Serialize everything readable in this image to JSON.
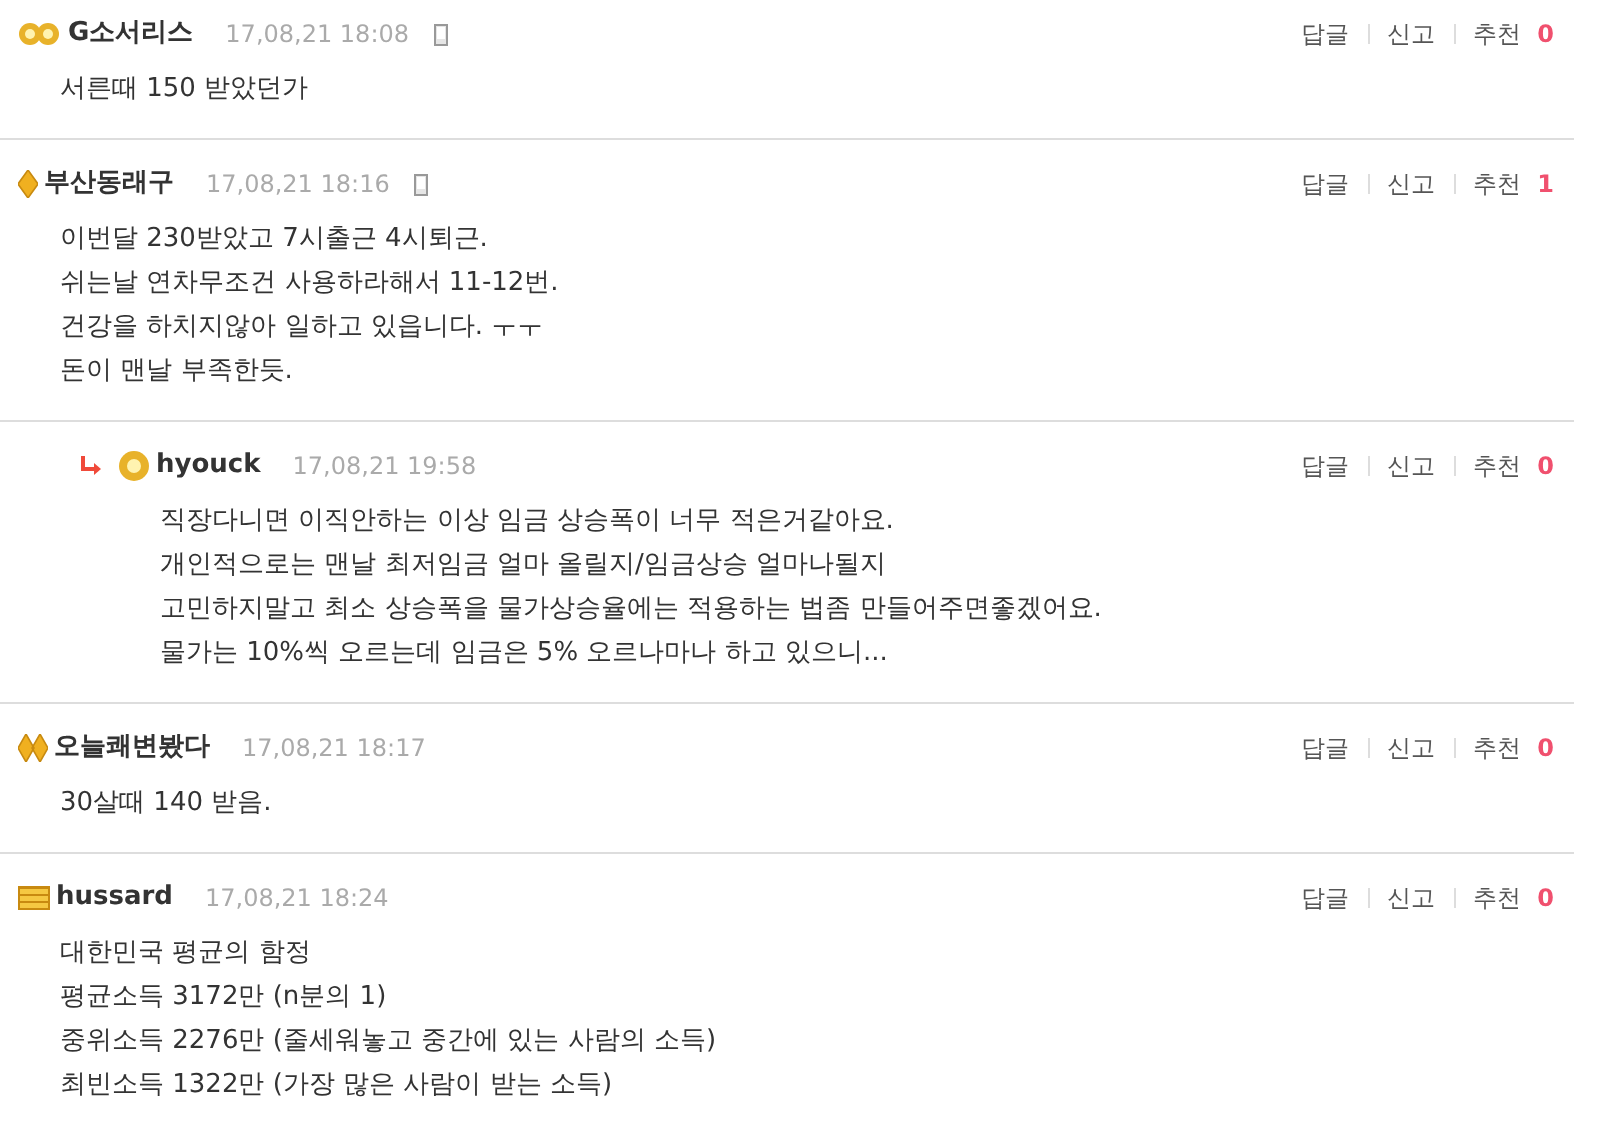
{
  "comments": [
    {
      "kind": "comment",
      "badge": {
        "kind": "flower-cluster"
      },
      "author": "G소서리스",
      "date": "17,08,21 18:08",
      "mobile": true,
      "actions": [
        "답글",
        "신고",
        "추천"
      ],
      "recommend_count": "0",
      "lines": [
        "서른때 150 받았던가"
      ]
    },
    {
      "kind": "comment",
      "badge": {
        "kind": "diamond"
      },
      "author": "부산동래구",
      "date": "17,08,21 18:16",
      "mobile": true,
      "actions": [
        "답글",
        "신고",
        "추천"
      ],
      "recommend_count": "1",
      "lines": [
        "이번달 230받았고 7시출근 4시퇴근.",
        "쉬는날 연차무조건 사용하라해서 11-12번.",
        "건강을 하치지않아 일하고 있읍니다. ㅜㅜ",
        "돈이 맨날 부족한듯."
      ]
    },
    {
      "kind": "reply",
      "badge": {
        "kind": "flower"
      },
      "author": "hyouck",
      "date": "17,08,21 19:58",
      "mobile": false,
      "actions": [
        "답글",
        "신고",
        "추천"
      ],
      "recommend_count": "0",
      "lines": [
        "직장다니면 이직안하는 이상 임금 상승폭이 너무 적은거같아요.",
        "개인적으로는 맨날 최저임금 얼마 올릴지/임금상승 얼마나될지",
        "고민하지말고 최소 상승폭을 물가상승율에는 적용하는 법좀 만들어주면좋겠어요.",
        "물가는 10%씩 오르는데 임금은 5% 오르나마나 하고 있으니..."
      ]
    },
    {
      "kind": "comment",
      "badge": {
        "kind": "double-diamond"
      },
      "author": "오늘쾌변봤다",
      "date": "17,08,21 18:17",
      "mobile": false,
      "actions": [
        "답글",
        "신고",
        "추천"
      ],
      "recommend_count": "0",
      "lines": [
        "30살때 140 받음."
      ]
    },
    {
      "kind": "comment",
      "badge": {
        "kind": "bars"
      },
      "author": "hussard",
      "date": "17,08,21 18:24",
      "mobile": false,
      "actions": [
        "답글",
        "신고",
        "추천"
      ],
      "recommend_count": "0",
      "lines": [
        "대한민국 평균의 함정",
        "평균소득 3172만 (n분의 1)",
        "중위소득 2276만 (줄세워놓고 중간에 있는 사람의 소득)",
        "최빈소득 1322만 (가장 많은 사람이 받는 소득)"
      ]
    }
  ]
}
